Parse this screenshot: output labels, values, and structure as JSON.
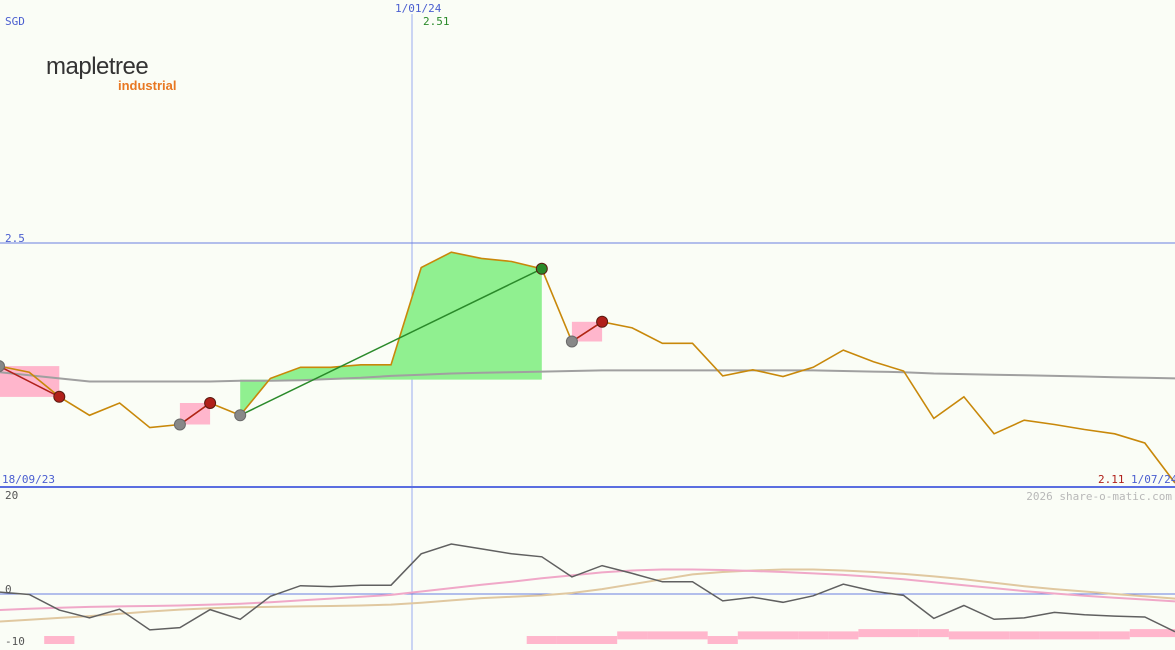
{
  "currency": "SGD",
  "logo": {
    "name": "mapletree",
    "sub": "industrial"
  },
  "watermark": "2026 share-o-matic.com",
  "colors": {
    "background": "#fafdf6",
    "price": "#c8880a",
    "long_ma": "#a0a0a0",
    "axis": "#6a7ee0",
    "gain_fill": "#90f090",
    "loss_fill": "#ffb6cc",
    "buy_marker": "#2a8a2a",
    "sell_marker": "#b0201a",
    "neutral_marker": "#888888",
    "macd_line": "#606060",
    "signal_line": "#f0a8c8",
    "tan_line": "#e0c8a0",
    "histogram": "#ffb6cc"
  },
  "chart_data": {
    "type": "line",
    "x_start_label": "18/09/23",
    "x_mid_label": "1/01/24",
    "x_end_label": "1/07/24",
    "price_start_label": "2.51",
    "price_end_label": "2.11",
    "ref_line_label": "2.5",
    "ref_line_value": 2.5,
    "ylim": [
      2.11,
      2.51
    ],
    "series": [
      {
        "key": "price",
        "values": [
          2.3,
          2.29,
          2.25,
          2.22,
          2.24,
          2.2,
          2.205,
          2.24,
          2.22,
          2.28,
          2.298,
          2.298,
          2.302,
          2.302,
          2.46,
          2.485,
          2.475,
          2.47,
          2.458,
          2.34,
          2.372,
          2.362,
          2.337,
          2.337,
          2.284,
          2.294,
          2.283,
          2.298,
          2.326,
          2.307,
          2.292,
          2.215,
          2.25,
          2.19,
          2.212,
          2.205,
          2.197,
          2.19,
          2.175,
          2.11
        ]
      },
      {
        "key": "long_ma",
        "values": [
          2.29,
          2.285,
          2.28,
          2.275,
          2.275,
          2.275,
          2.275,
          2.275,
          2.276,
          2.276,
          2.277,
          2.279,
          2.281,
          2.284,
          2.286,
          2.288,
          2.289,
          2.29,
          2.291,
          2.292,
          2.293,
          2.293,
          2.293,
          2.293,
          2.293,
          2.293,
          2.293,
          2.293,
          2.292,
          2.291,
          2.29,
          2.288,
          2.287,
          2.286,
          2.285,
          2.284,
          2.283,
          2.282,
          2.281,
          2.28
        ]
      }
    ],
    "trades": [
      {
        "entry_index": 0,
        "exit_index": 2,
        "result": "loss"
      },
      {
        "entry_index": 6,
        "exit_index": 7,
        "result": "loss"
      },
      {
        "entry_index": 8,
        "exit_index": 18,
        "result": "gain"
      },
      {
        "entry_index": 19,
        "exit_index": 20,
        "result": "loss"
      }
    ],
    "indicator": {
      "ticks": [
        "20",
        "0",
        "-10"
      ],
      "ylim": [
        -10,
        20
      ],
      "macd": [
        0.4,
        -0.1,
        -3.5,
        -5.2,
        -3.3,
        -7.8,
        -7.3,
        -3.4,
        -5.5,
        -0.5,
        1.7,
        1.5,
        1.8,
        1.8,
        8.2,
        10.2,
        9.2,
        8.2,
        7.6,
        3.5,
        5.8,
        4.2,
        2.5,
        2.5,
        -1.5,
        -0.7,
        -1.8,
        -0.4,
        2.0,
        0.6,
        -0.3,
        -5.3,
        -2.5,
        -5.5,
        -5.2,
        -4.0,
        -4.5,
        -4.8,
        -5.0,
        -8.2
      ],
      "signal": [
        -3.5,
        -3.2,
        -3.0,
        -2.8,
        -2.7,
        -2.6,
        -2.5,
        -2.3,
        -2.1,
        -1.8,
        -1.4,
        -1.0,
        -0.6,
        -0.2,
        0.5,
        1.2,
        1.9,
        2.5,
        3.2,
        3.8,
        4.4,
        4.8,
        5.0,
        5.0,
        4.9,
        4.7,
        4.5,
        4.2,
        3.9,
        3.5,
        3.0,
        2.4,
        1.8,
        1.2,
        0.6,
        0.1,
        -0.4,
        -0.8,
        -1.2,
        -1.6
      ],
      "trend": [
        -6.0,
        -5.6,
        -5.2,
        -4.8,
        -4.3,
        -3.8,
        -3.4,
        -3.1,
        -2.9,
        -2.8,
        -2.7,
        -2.6,
        -2.5,
        -2.3,
        -1.9,
        -1.4,
        -0.9,
        -0.6,
        -0.3,
        0.2,
        1.0,
        2.0,
        3.0,
        4.0,
        4.5,
        4.8,
        5.0,
        5.0,
        4.8,
        4.5,
        4.1,
        3.6,
        3.0,
        2.3,
        1.6,
        1.0,
        0.5,
        0.0,
        -0.5,
        -1.0
      ],
      "histogram": [
        0,
        0,
        -10,
        0,
        0,
        0,
        0,
        0,
        0,
        0,
        0,
        0,
        0,
        0,
        0,
        0,
        0,
        0,
        -10,
        -10,
        -10,
        -9,
        -9,
        -9,
        -10,
        -9,
        -9,
        -9,
        -9,
        -8.5,
        -8.5,
        -8.5,
        -9,
        -9,
        -9,
        -9,
        -9,
        -9,
        -8.5,
        -8.5
      ]
    }
  }
}
